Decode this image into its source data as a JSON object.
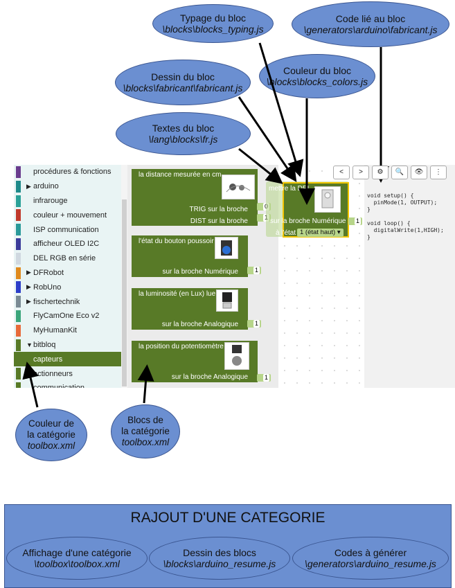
{
  "callouts": {
    "typing": {
      "title": "Typage du bloc",
      "path": "\\blocks\\blocks_typing.js"
    },
    "code": {
      "title": "Code lié au bloc",
      "path": "\\generators\\arduino\\fabricant.js"
    },
    "drawing": {
      "title": "Dessin du bloc",
      "path": "\\blocks\\fabricant\\fabricant.js"
    },
    "color": {
      "title": "Couleur du bloc",
      "path": "\\blocks\\blocks_colors.js"
    },
    "texts": {
      "title": "Textes du bloc",
      "path": "\\lang\\blocks\\fr.js"
    },
    "category_color": {
      "line1": "Couleur de",
      "line2": "la catégorie",
      "path": "toolbox.xml"
    },
    "category_blocks": {
      "line1": "Blocs de",
      "line2": "la catégorie",
      "path": "toolbox.xml"
    }
  },
  "toolbox": {
    "items": [
      {
        "label": "procédures & fonctions",
        "color": "#6a3c8e",
        "arrow": ""
      },
      {
        "label": "arduino",
        "color": "#1e8a8a",
        "arrow": "▶"
      },
      {
        "label": "infrarouge",
        "color": "#2aa198",
        "arrow": ""
      },
      {
        "label": "couleur + mouvement",
        "color": "#c0392b",
        "arrow": ""
      },
      {
        "label": "ISP communication",
        "color": "#2a9a9a",
        "arrow": ""
      },
      {
        "label": "afficheur OLED I2C",
        "color": "#3b3b9a",
        "arrow": ""
      },
      {
        "label": "DEL RGB en série",
        "color": "#d0d8e0",
        "arrow": ""
      },
      {
        "label": "DFRobot",
        "color": "#e08a1e",
        "arrow": "▶"
      },
      {
        "label": "RobUno",
        "color": "#2c3ec9",
        "arrow": "▶"
      },
      {
        "label": "fischertechnik",
        "color": "#7a8a94",
        "arrow": "▶"
      },
      {
        "label": "FlyCamOne Eco v2",
        "color": "#3aa57a",
        "arrow": ""
      },
      {
        "label": "MyHumanKit",
        "color": "#e86a3a",
        "arrow": ""
      },
      {
        "label": "bitbloq",
        "color": "#587a27",
        "arrow": "▼"
      },
      {
        "label": "capteurs",
        "color": "#587a27",
        "arrow": "",
        "selected": true
      },
      {
        "label": "actionneurs",
        "color": "#587a27",
        "arrow": ""
      },
      {
        "label": "communication",
        "color": "#587a27",
        "arrow": ""
      }
    ]
  },
  "flyout": {
    "b1": {
      "title": "la distance mesurée en cm",
      "trig": "TRIG sur la broche",
      "trig_val": "0",
      "dist": "DIST sur la broche",
      "dist_val": "1"
    },
    "b2": {
      "title": "l'état du bouton poussoir",
      "pin": "sur la broche Numérique",
      "val": "1"
    },
    "b3": {
      "title": "la luminosité (en Lux) lue",
      "pin": "sur la broche Analogique",
      "val": "1"
    },
    "b4": {
      "title": "la position du potentiomètre",
      "pin": "sur la broche Analogique",
      "val": "1"
    }
  },
  "workspace": {
    "block": {
      "title": "mettre la DEL",
      "pin": "sur la broche Numérique",
      "pin_val": "1",
      "state_label": "à l'état",
      "state_value": "1 (état haut)"
    },
    "toolbar": [
      "<",
      ">",
      "⚙",
      "🔍",
      "👁",
      "⋮"
    ]
  },
  "code": {
    "lines": [
      "void setup() {",
      "  pinMode(1, OUTPUT);",
      "}",
      "",
      "void loop() {",
      "  digitalWrite(1,HIGH);",
      "}"
    ]
  },
  "banner": {
    "title": "RAJOUT D'UNE CATEGORIE",
    "e1": {
      "line1": "Affichage d'une catégorie",
      "path": "\\toolbox\\toolbox.xml"
    },
    "e2": {
      "line1": "Dessin des blocs",
      "path": "\\blocks\\arduino_resume.js"
    },
    "e3": {
      "line1": "Codes à générer",
      "path": "\\generators\\arduino_resume.js"
    }
  },
  "colors": {
    "callout_fill": "#6b8fd1",
    "block_green": "#587a27",
    "highlight": "#f2c500"
  }
}
